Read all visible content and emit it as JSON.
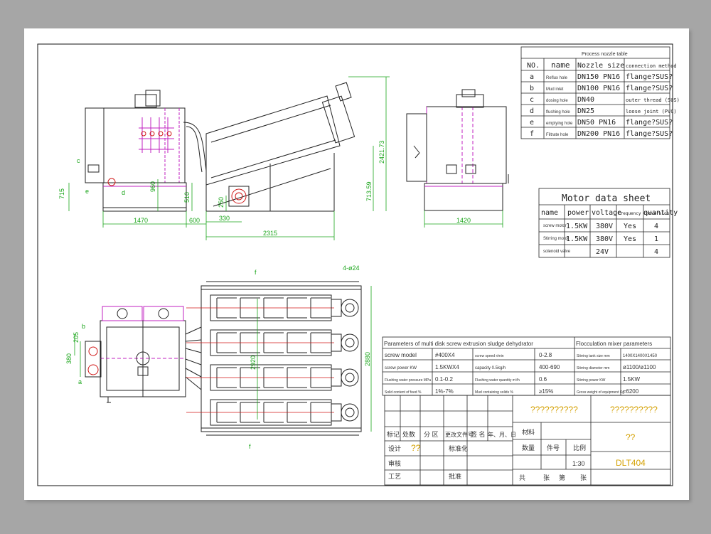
{
  "colors": {
    "background": "#a6a6a6",
    "sheet": "#ffffff",
    "line": "#202020",
    "dimension": "#1aa51a",
    "magenta": "#c020c0",
    "red": "#d01818",
    "title_text": "#d4a000"
  },
  "nozzle_table": {
    "title": "Process nozzle table",
    "headers": [
      "NO.",
      "name",
      "Nozzle size",
      "connection method"
    ],
    "rows": [
      [
        "a",
        "Reflux hole",
        "DN150 PN16",
        "flange?SUS?"
      ],
      [
        "b",
        "Mud inlet",
        "DN100 PN16",
        "flange?SUS?"
      ],
      [
        "c",
        "dosing hole",
        "DN40",
        "outer thread (SUS)"
      ],
      [
        "d",
        "flushing hole",
        "DN25",
        "loose joint (PVC)"
      ],
      [
        "e",
        "emptying hole",
        "DN50 PN16",
        "flange?SUS?"
      ],
      [
        "f",
        "Filtrate hole",
        "DN200 PN16",
        "flange?SUS?"
      ]
    ]
  },
  "motor_table": {
    "title": "Motor data sheet",
    "headers": [
      "name",
      "power",
      "voltage",
      "frequency conversion",
      "quantity"
    ],
    "rows": [
      [
        "screw motor",
        "1.5KW",
        "380V",
        "Yes",
        "4"
      ],
      [
        "Stirring motor",
        "1.5KW",
        "380V",
        "Yes",
        "1"
      ],
      [
        "solenoid valve",
        "",
        "24V",
        "",
        "4"
      ]
    ]
  },
  "param_table": {
    "title_left": "Parameters of multi disk screw extrusion sludge dehydrator",
    "title_right": "Flocculation mixer parameters",
    "rows": [
      [
        "screw model",
        "#400X4",
        "screw speed r/min",
        "0-2.8",
        "Stirring tank size mm",
        "1400X1400X1450"
      ],
      [
        "screw power KW",
        "1.5KWX4",
        "capacity 0.5kg/h",
        "400-690",
        "Stirring diameter mm",
        "ø1100/ø1100"
      ],
      [
        "Flushing water pressure MPa",
        "0.1-0.2",
        "Flushing water quantity m³/h",
        "0.6",
        "Stirring power KW",
        "1.5KW"
      ],
      [
        "Solid content of feed %",
        "1%-7%",
        "Mud containing solids %",
        "≥15%",
        "Gross weight of equipment Kg",
        "≈6200"
      ]
    ]
  },
  "title_block": {
    "unknown_1": "??????????",
    "unknown_2": "??????????",
    "unknown_3": "??",
    "drawing_no": "DLT404",
    "scale": "1:30",
    "labels": {
      "mark": "标记",
      "count": "处数",
      "zone": "分 区",
      "doc": "更改文件号",
      "sign": "签 名",
      "date": "年、月、日",
      "design": "设计",
      "design_val": "??",
      "standard": "标准化",
      "material": "材料",
      "qty": "数量",
      "weight": "件号",
      "ratio": "比例",
      "audit": "审核",
      "process": "工艺",
      "approve": "批准",
      "total": "共",
      "sheets": "张",
      "page": "第",
      "page2": "张"
    }
  },
  "dimensions": {
    "d_715": "715",
    "d_960": "960",
    "d_510": "510",
    "d_250": "250",
    "d_2421": "2421.73",
    "d_713": "713.59",
    "d_1470": "1470",
    "d_600": "600",
    "d_330": "330",
    "d_2315": "2315",
    "d_1420": "1420",
    "d_4x24": "4-ø24",
    "d_205": "205",
    "d_380": "380",
    "d_2920": "2920",
    "d_2880": "2880"
  },
  "callouts": {
    "a": "a",
    "b": "b",
    "c": "c",
    "d": "d",
    "e": "e",
    "f": "f"
  }
}
